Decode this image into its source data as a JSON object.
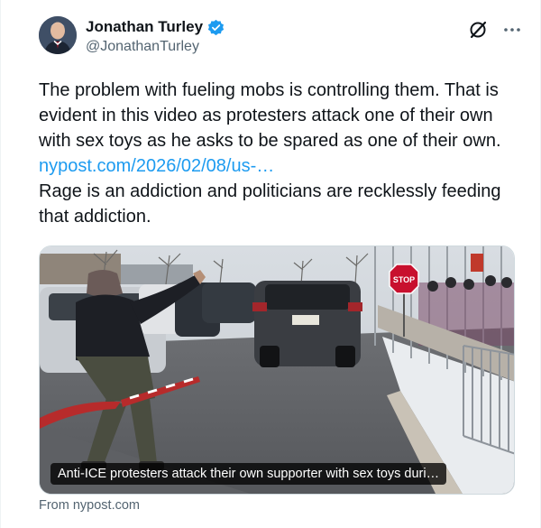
{
  "author": {
    "display_name": "Jonathan Turley",
    "handle": "@JonathanTurley"
  },
  "icons": {
    "verified": "verified-badge-icon",
    "grok": "grok-icon",
    "more": "more-icon",
    "verified_color": "#1d9bf0"
  },
  "tweet": {
    "text_before_link": "The problem with fueling mobs is controlling them. That is evident in this video as protesters attack one of their own with sex toys as he asks to be spared as one of their own.",
    "link": "nypost.com/2026/02/08/us-…",
    "text_after_link": "Rage is an addiction and politicians are recklessly feeding that addiction."
  },
  "media": {
    "caption": "Anti-ICE protesters attack their own supporter with sex toys duri…",
    "stop_sign_text": "STOP"
  },
  "source_label": "From nypost.com",
  "colors": {
    "link": "#1d9bf0",
    "text": "#0f1419",
    "secondary": "#536471"
  }
}
